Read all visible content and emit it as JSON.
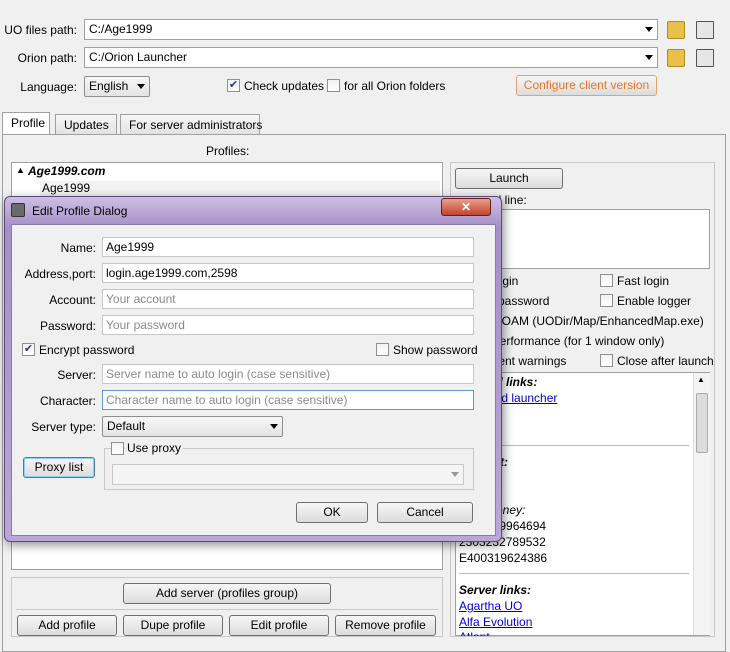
{
  "main": {
    "uo_path_label": "UO files path:",
    "uo_path_value": "C:/Age1999",
    "orion_path_label": "Orion path:",
    "orion_path_value": "C:/Orion Launcher",
    "language_label": "Language:",
    "language_value": "English",
    "check_updates_label": "Check updates",
    "check_updates_checked": true,
    "all_folders_label": "for all Orion folders",
    "all_folders_checked": false,
    "configure_label": "Configure client version",
    "accent_color": "#e8762b"
  },
  "tabs": [
    {
      "label": "Profile",
      "active": true
    },
    {
      "label": "Updates",
      "active": false
    },
    {
      "label": "For server administrators",
      "active": false
    }
  ],
  "profiles": {
    "header": "Profiles:",
    "group": "Age1999.com",
    "item": "Age1999"
  },
  "right": {
    "launch_label": "Launch",
    "command_line_partial": "nd line:",
    "opt_login_partial": "login",
    "opt_fast_login": "Fast login",
    "opt_password_partial": "e password",
    "opt_enable_logger": "Enable logger",
    "opt_uoam_partial": "UOAM (UODir/Map/EnhancedMap.exe)",
    "opt_perf_partial": "performance (for 1 window only)",
    "opt_warnings_partial": "lient warnings",
    "opt_close_after": "Close after launch",
    "links_header_partial": "ral links:",
    "link_download_partial": "oad launcher",
    "link_d_partial": "d",
    "support_partial": "ort:",
    "support_link1_partial": "l",
    "support_link2_partial": "on",
    "money_partial": "Money:",
    "money1_partial": "329964694",
    "money2_partial": "2303232789532",
    "money3": "E400319624386",
    "server_links_header": "Server links:",
    "server_links": [
      "Agartha UO",
      "Alfa Evolution",
      "Atlant"
    ]
  },
  "bottom": {
    "add_server": "Add server (profiles group)",
    "add_profile": "Add profile",
    "dupe_profile": "Dupe profile",
    "edit_profile": "Edit profile",
    "remove_profile": "Remove profile"
  },
  "dialog": {
    "title": "Edit Profile Dialog",
    "name_label": "Name:",
    "name_value": "Age1999",
    "address_label": "Address,port:",
    "address_value": "login.age1999.com,2598",
    "account_label": "Account:",
    "account_placeholder": "Your account",
    "password_label": "Password:",
    "password_placeholder": "Your password",
    "encrypt_label": "Encrypt password",
    "encrypt_checked": true,
    "show_password_label": "Show password",
    "show_password_checked": false,
    "server_label": "Server:",
    "server_placeholder": "Server name to auto login (case sensitive)",
    "character_label": "Character:",
    "character_placeholder": "Character name to auto login (case sensitive)",
    "server_type_label": "Server type:",
    "server_type_value": "Default",
    "use_proxy_label": "Use proxy",
    "use_proxy_checked": false,
    "proxy_list_label": "Proxy list",
    "ok_label": "OK",
    "cancel_label": "Cancel",
    "frame_color": "#a68fc8"
  }
}
